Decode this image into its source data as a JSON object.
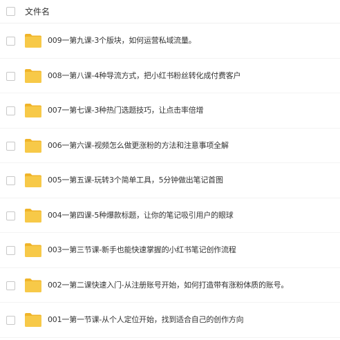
{
  "header": {
    "column_label": "文件名"
  },
  "icons": {
    "folder": "folder-icon",
    "checkbox": "checkbox-unchecked"
  },
  "colors": {
    "folder_body": "#f7c948",
    "folder_tab": "#f0b429"
  },
  "files": [
    {
      "name": "009一第九课-3个版块，如何运营私域流量。"
    },
    {
      "name": "008一第八课-4种导流方式，把小红书粉丝转化成付费客户"
    },
    {
      "name": "007一第七课-3种热门选题技巧，让点击率倍增"
    },
    {
      "name": "006一第六课-视频怎么做更涨粉的方法和注意事项全解"
    },
    {
      "name": "005一第五课-玩转3个简单工具，5分钟做出笔记首图"
    },
    {
      "name": "004一第四课-5种爆款标题，让你的笔记吸引用户的眼球"
    },
    {
      "name": "003一第三节课-新手也能快速掌握的小红书笔记创作流程"
    },
    {
      "name": "002一第二课快速入门-从注册账号开始，如何打造带有涨粉体质的账号。"
    },
    {
      "name": "001一第一节课-从个人定位开始，找到适合自己的创作方向"
    }
  ]
}
